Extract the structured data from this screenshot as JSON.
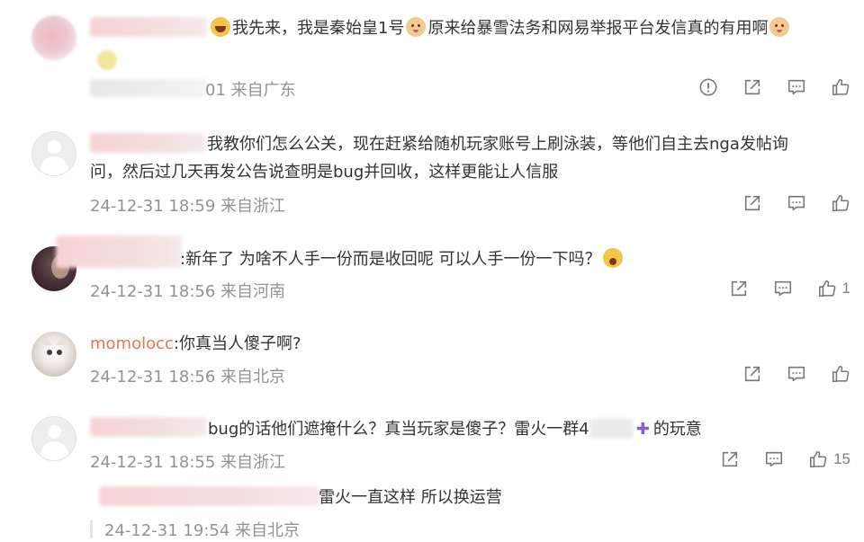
{
  "comments": [
    {
      "text": "我先来，我是秦始皇1号",
      "text2": "原来给暴雪法务和网易举报平台发信真的有用啊",
      "meta": "01 来自广东",
      "like_count": ""
    },
    {
      "text_line1": "我教你们怎么公关，现在赶紧给随机玩家账号上刷泳装，等他们自主去nga发帖询",
      "text_line2": "问，然后过几天再发公告说查明是bug并回收，这样更能让人信服",
      "meta": "24-12-31 18:59 来自浙江",
      "like_count": ""
    },
    {
      "text": ":新年了 为啥不人手一份而是收回呢 可以人手一份一下吗？",
      "meta": "24-12-31 18:56 来自河南",
      "like_count": "1"
    },
    {
      "name": "momolocc",
      "text": ":你真当人傻子啊?",
      "meta": "24-12-31 18:56 来自北京",
      "like_count": ""
    },
    {
      "text_a": "bug的话他们遮掩什么？真当玩家是傻子？雷火一群4",
      "plus": "✚",
      "text_b": "的玩意",
      "meta": "24-12-31 18:55 来自浙江",
      "like_count": "15"
    },
    {
      "text": "雷火一直这样 所以换运营",
      "meta": "24-12-31 19:54 来自北京"
    }
  ],
  "icons": {
    "report": "report-icon",
    "share": "share-icon",
    "reply": "comment-icon",
    "like": "thumbs-up-icon"
  },
  "colors": {
    "username": "#eb7350",
    "meta": "#939393",
    "icon": "#808080"
  }
}
